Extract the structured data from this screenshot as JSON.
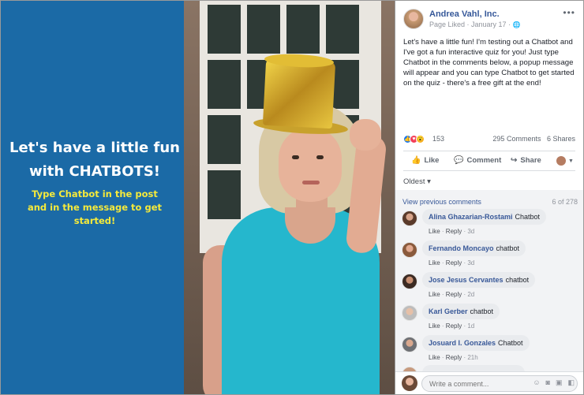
{
  "image": {
    "headline_line1": "Let's have a little fun",
    "headline_line2": "with CHATBOTS!",
    "subline_line1": "Type Chatbot in the post",
    "subline_line2": "and in the message to get started!"
  },
  "post": {
    "page_name": "Andrea Vahl, Inc.",
    "meta": "Page Liked · January 17 ·",
    "text": "Let's have a little fun! I'm testing out a Chatbot and I've got a fun interactive quiz for you! Just type Chatbot in the comments below, a popup message will appear and you can type Chatbot to get started on the quiz - there's a free gift at the end!",
    "reaction_count": "153",
    "comments_count": "295 Comments",
    "shares_count": "6 Shares",
    "actions": {
      "like": "Like",
      "comment": "Comment",
      "share": "Share"
    },
    "colors": {
      "like_blue": "#1877f2",
      "love_red": "#f33e58",
      "wow_yellow": "#f7b125",
      "name_blue": "#385898"
    }
  },
  "comments": {
    "sort_label": "Oldest ▾",
    "view_previous": "View previous comments",
    "count": "6 of 278",
    "items": [
      {
        "name": "Alina Ghazarian-Rostami",
        "text": "Chatbot",
        "like": "Like",
        "reply": "Reply",
        "time": "3d"
      },
      {
        "name": "Fernando Moncayo",
        "text": "chatbot",
        "like": "Like",
        "reply": "Reply",
        "time": "3d"
      },
      {
        "name": "Jose Jesus Cervantes",
        "text": "chatbot",
        "like": "Like",
        "reply": "Reply",
        "time": "2d"
      },
      {
        "name": "Karl Gerber",
        "text": "chatbot",
        "like": "Like",
        "reply": "Reply",
        "time": "1d"
      },
      {
        "name": "Josuard I. Gonzales",
        "text": "Chatbot",
        "like": "Like",
        "reply": "Reply",
        "time": "21h"
      }
    ],
    "composer_placeholder": "Write a comment..."
  }
}
